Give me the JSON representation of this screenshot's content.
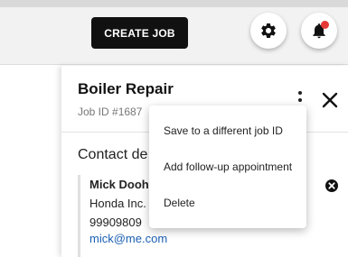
{
  "header": {
    "create_job_label": "CREATE JOB",
    "settings_icon": "gear-icon",
    "notifications_icon": "bell-icon",
    "notification_dot_color": "#e53935"
  },
  "job_panel": {
    "title": "Boiler Repair",
    "job_id": "Job ID #1687",
    "more_icon": "kebab-icon",
    "close_icon": "close-icon"
  },
  "contact": {
    "section_title": "Contact de",
    "name": "Mick Dooh",
    "company": "Honda Inc.",
    "phone": "99909809",
    "email": "mick@me.com",
    "email_color": "#1a5fb4"
  },
  "dropdown_menu": {
    "items": [
      {
        "label": "Save to a different job ID"
      },
      {
        "label": "Add follow-up appointment"
      },
      {
        "label": "Delete"
      }
    ]
  }
}
